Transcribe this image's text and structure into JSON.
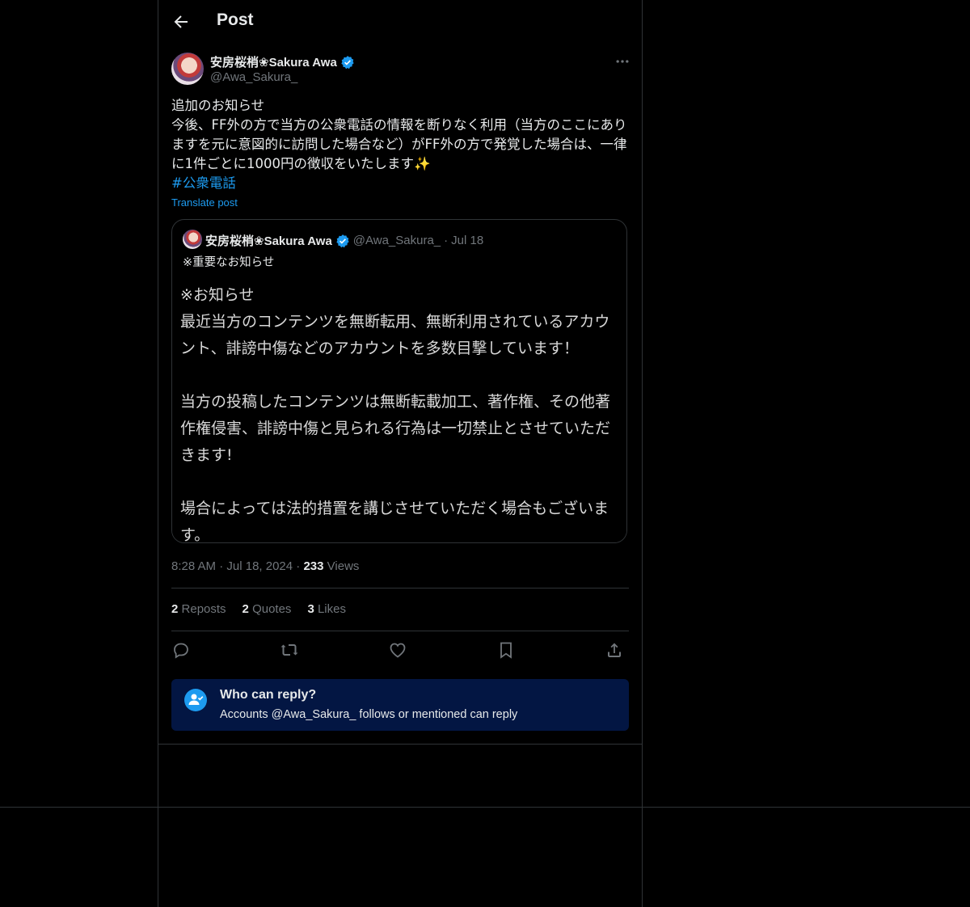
{
  "header": {
    "title": "Post"
  },
  "post": {
    "display_name": "安房桜梢❀Sakura Awa",
    "handle": "@Awa_Sakura_",
    "text": "追加のお知らせ\n今後、FF外の方で当方の公衆電話の情報を断りなく利用（当方のここにありますを元に意図的に訪問した場合など）がFF外の方で発覚した場合は、一律に1件ごとに1000円の徴収をいたします✨",
    "hashtag": "#公衆電話",
    "translate_label": "Translate post",
    "time": "8:28 AM",
    "date": "Jul 18, 2024",
    "views_count": "233",
    "views_label": "Views"
  },
  "quote": {
    "display_name": "安房桜梢❀Sakura Awa",
    "handle": "@Awa_Sakura_",
    "separator": "·",
    "date": "Jul 18",
    "text": "※重要なお知らせ",
    "image_text": "※お知らせ\n最近当方のコンテンツを無断転用、無断利用されているアカウント、誹謗中傷などのアカウントを多数目撃しています！\n\n当方の投稿したコンテンツは無断転載加工、著作権、その他著作権侵害、誹謗中傷と見られる行為は一切禁止とさせていただきます!\n\n場合によっては法的措置を講じさせていただく場合もございます。"
  },
  "stats": {
    "reposts_count": "2",
    "reposts_label": "Reposts",
    "quotes_count": "2",
    "quotes_label": "Quotes",
    "likes_count": "3",
    "likes_label": "Likes"
  },
  "who_can_reply": {
    "title": "Who can reply?",
    "body": "Accounts @Awa_Sakura_ follows or mentioned can reply"
  },
  "icons": {
    "back": "arrow-left-icon",
    "more": "more-horizontal-icon",
    "verified": "verified-badge-icon",
    "reply": "reply-icon",
    "repost": "repost-icon",
    "like": "heart-icon",
    "bookmark": "bookmark-icon",
    "share": "share-icon",
    "who_can_reply": "user-check-icon"
  },
  "colors": {
    "background": "#000000",
    "accent": "#1d9bf0",
    "muted": "#71767b",
    "border": "#2f3336",
    "notice_bg": "#031643"
  }
}
